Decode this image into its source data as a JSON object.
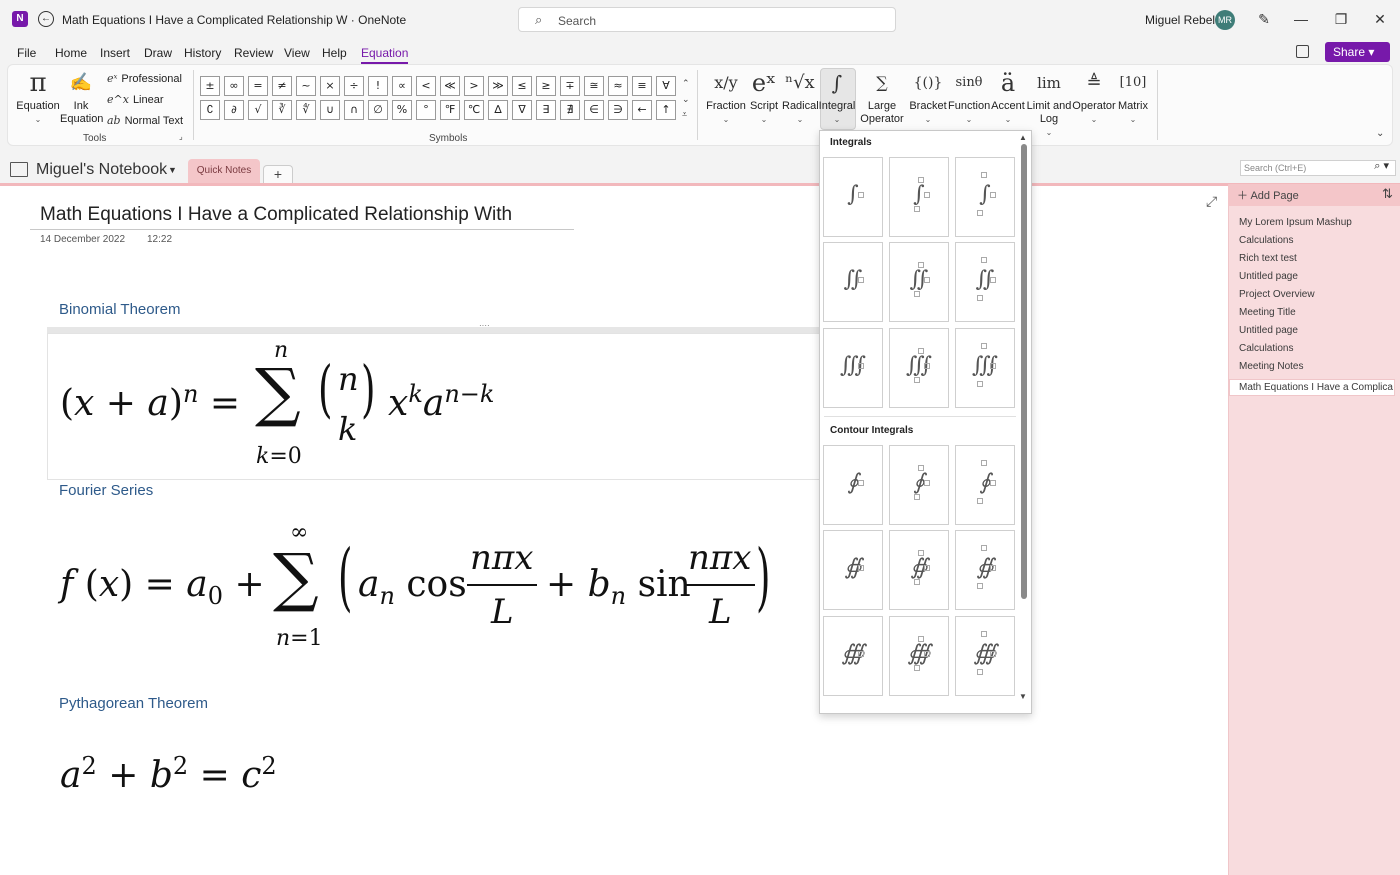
{
  "titlebar": {
    "window_title": "Math Equations I Have a Complicated Relationship W  ·  OneNote",
    "search_placeholder": "Search",
    "user_name": "Miguel Rebelo",
    "avatar_initials": "MR"
  },
  "menu": {
    "items": [
      "File",
      "Home",
      "Insert",
      "Draw",
      "History",
      "Review",
      "View",
      "Help",
      "Equation"
    ],
    "active": "Equation",
    "share_label": "Share"
  },
  "ribbon": {
    "tools": {
      "equation_label": "Equation",
      "ink_label": "Ink\nEquation",
      "options": [
        "Professional",
        "Linear",
        "Normal Text"
      ],
      "group_label": "Tools"
    },
    "symbols": {
      "row1": [
        "±",
        "∞",
        "=",
        "≠",
        "~",
        "×",
        "÷",
        "!",
        "∝",
        "<",
        "≪",
        ">",
        "≫",
        "≤",
        "≥",
        "∓",
        "≅",
        "≈",
        "≡",
        "∀"
      ],
      "row2": [
        "∁",
        "∂",
        "√",
        "∛",
        "∜",
        "∪",
        "∩",
        "∅",
        "%",
        "°",
        "℉",
        "℃",
        "∆",
        "∇",
        "∃",
        "∄",
        "∈",
        "∋",
        "←",
        "↑"
      ],
      "group_label": "Symbols"
    },
    "structures": [
      {
        "label": "Fraction",
        "icon": "x/y"
      },
      {
        "label": "Script",
        "icon": "eˣ"
      },
      {
        "label": "Radical",
        "icon": "ⁿ√x"
      },
      {
        "label": "Integral",
        "icon": "∫"
      },
      {
        "label": "Large\nOperator",
        "icon": "∑"
      },
      {
        "label": "Bracket",
        "icon": "{()}"
      },
      {
        "label": "Function",
        "icon": "sinθ"
      },
      {
        "label": "Accent",
        "icon": "ä"
      },
      {
        "label": "Limit and\nLog",
        "icon": "lim"
      },
      {
        "label": "Operator",
        "icon": "≜"
      },
      {
        "label": "Matrix",
        "icon": "[10]"
      }
    ]
  },
  "notebook": {
    "name": "Miguel's Notebook",
    "section_tab": "Quick Notes",
    "add_tab": "+",
    "page_search_placeholder": "Search (Ctrl+E)"
  },
  "page": {
    "title": "Math Equations I Have a Complicated Relationship With",
    "date": "14 December 2022",
    "time": "12:22",
    "sections": [
      {
        "heading": "Binomial Theorem"
      },
      {
        "heading": "Fourier Series"
      },
      {
        "heading": "Pythagorean Theorem"
      }
    ]
  },
  "pages_pane": {
    "add_page_label": "Add Page",
    "items": [
      "My Lorem Ipsum Mashup",
      "Calculations",
      "Rich text test",
      "Untitled page",
      "Project Overview",
      "Meeting Title",
      "Untitled page",
      "Calculations",
      "Meeting Notes",
      "Math Equations I Have a Complica"
    ],
    "current_index": 9
  },
  "integral_dropdown": {
    "section1": "Integrals",
    "section2": "Contour Integrals"
  },
  "colors": {
    "accent": "#7719aa",
    "section_pink": "#f4c6c9",
    "pane_pink": "#f8dcde",
    "heading_blue": "#2e5a8a"
  }
}
